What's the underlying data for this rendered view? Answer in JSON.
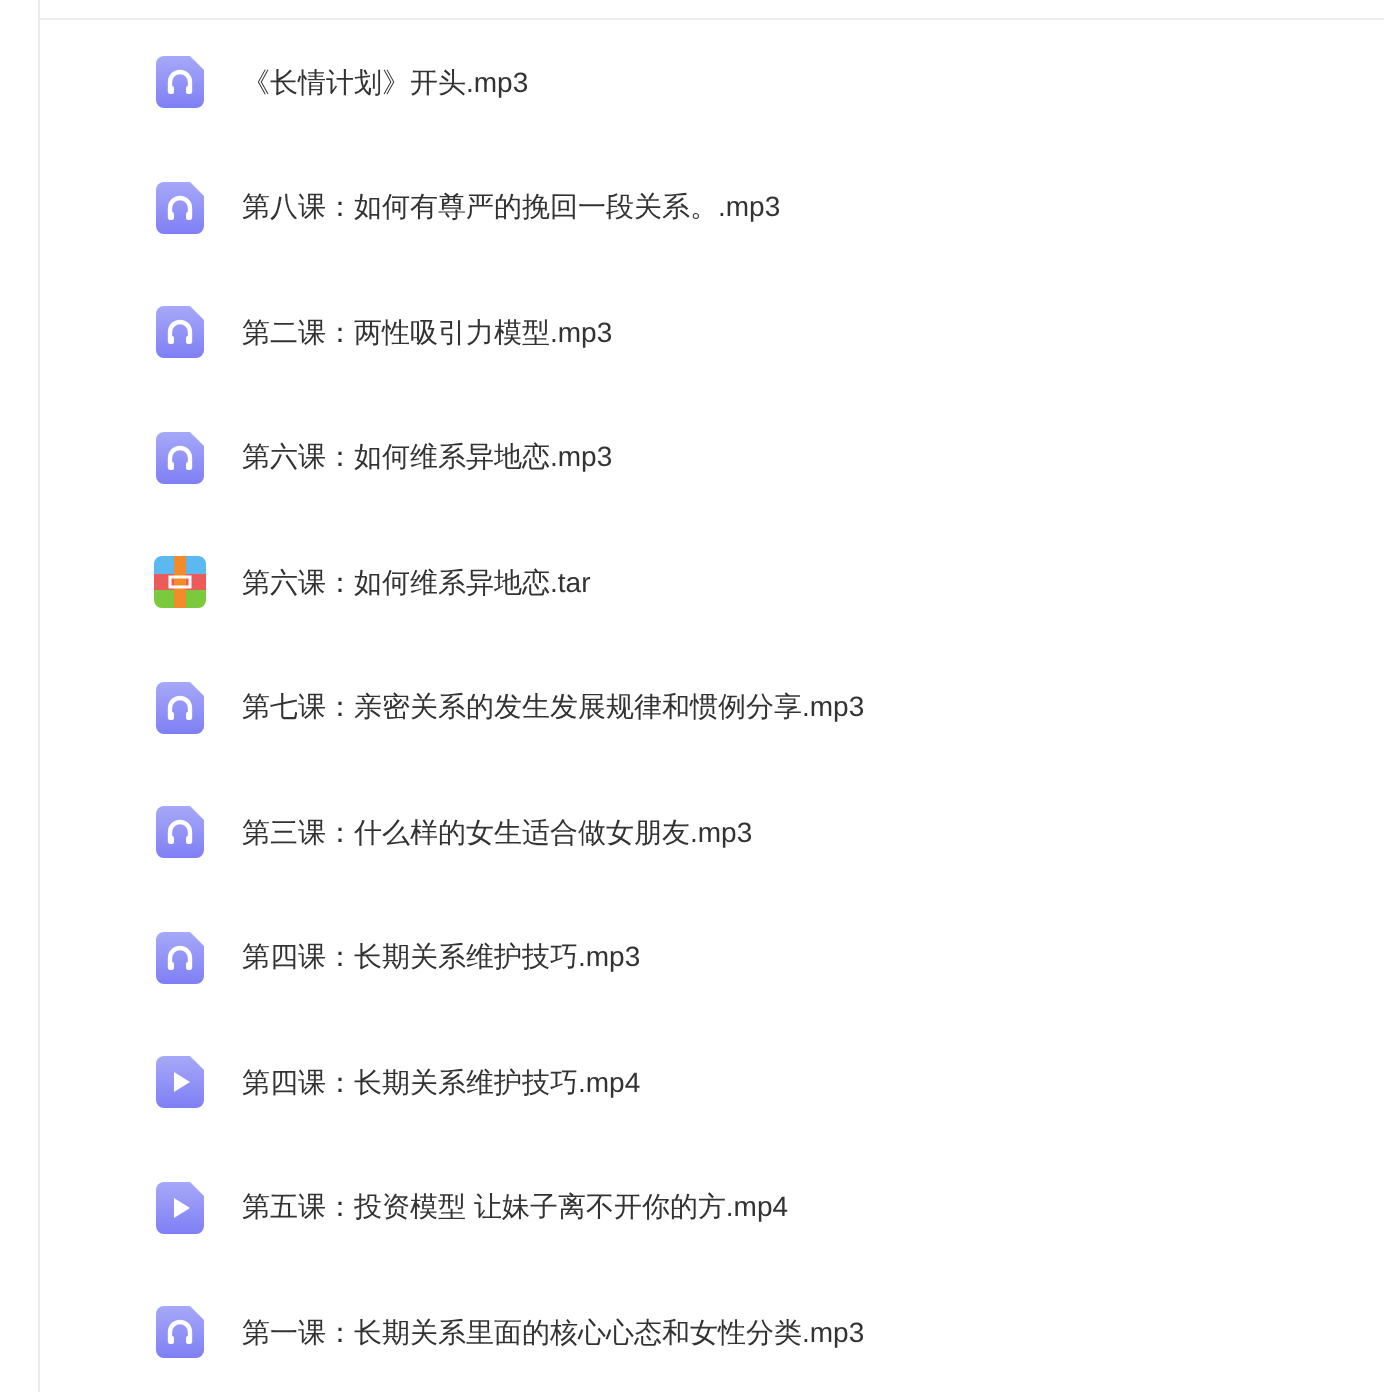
{
  "files": [
    {
      "kind": "audio",
      "name": "《长情计划》开头.mp3"
    },
    {
      "kind": "audio",
      "name": "第八课：如何有尊严的挽回一段关系。.mp3"
    },
    {
      "kind": "audio",
      "name": "第二课：两性吸引力模型.mp3"
    },
    {
      "kind": "audio",
      "name": "第六课：如何维系异地恋.mp3"
    },
    {
      "kind": "archive",
      "name": "第六课：如何维系异地恋.tar"
    },
    {
      "kind": "audio",
      "name": "第七课：亲密关系的发生发展规律和惯例分享.mp3"
    },
    {
      "kind": "audio",
      "name": "第三课：什么样的女生适合做女朋友.mp3"
    },
    {
      "kind": "audio",
      "name": "第四课：长期关系维护技巧.mp3"
    },
    {
      "kind": "video",
      "name": "第四课：长期关系维护技巧.mp4"
    },
    {
      "kind": "video",
      "name": "第五课：投资模型 让妹子离不开你的方.mp4"
    },
    {
      "kind": "audio",
      "name": "第一课：长期关系里面的核心心态和女性分类.mp3"
    }
  ]
}
